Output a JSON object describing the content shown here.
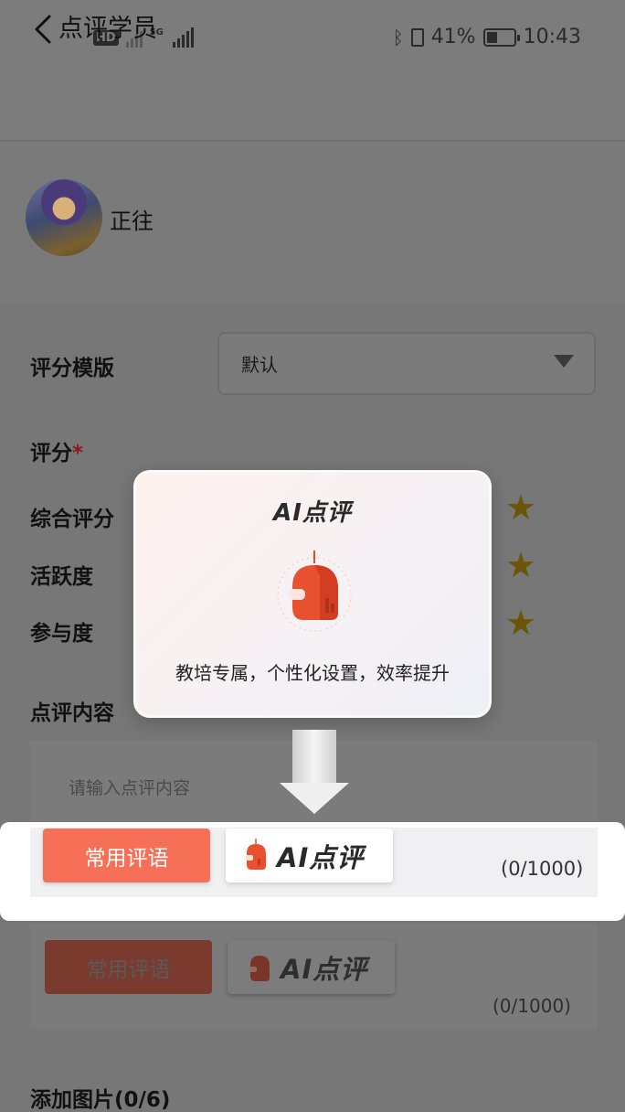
{
  "status_bar": {
    "hd_label": "HD",
    "network_label": "5G",
    "battery_percent": "41%",
    "battery_level": 0.41,
    "time": "10:43"
  },
  "nav": {
    "title": "点评学员"
  },
  "user": {
    "name": "正往"
  },
  "form": {
    "template_label": "评分模版",
    "template_value": "默认",
    "rating_label": "评分",
    "required_mark": "*",
    "ratings": [
      {
        "label": "综合评分"
      },
      {
        "label": "活跃度"
      },
      {
        "label": "参与度"
      }
    ],
    "comment_label": "点评内容",
    "comment_placeholder": "请输入点评内容",
    "common_phrases_button": "常用评语",
    "ai_button": "AI点评",
    "counter": "(0/1000)",
    "add_image_label": "添加图片(0/6)"
  },
  "popup": {
    "title": "AI点评",
    "description": "教培专属，个性化设置，效率提升"
  },
  "colors": {
    "accent": "#f57057",
    "star": "#6b5608",
    "overlay": "#777778"
  },
  "icons": {
    "back": "back-arrow-icon",
    "dropdown": "caret-down-icon",
    "star": "star-icon",
    "ai_robot": "ai-robot-icon",
    "down_arrow": "down-arrow-icon"
  }
}
